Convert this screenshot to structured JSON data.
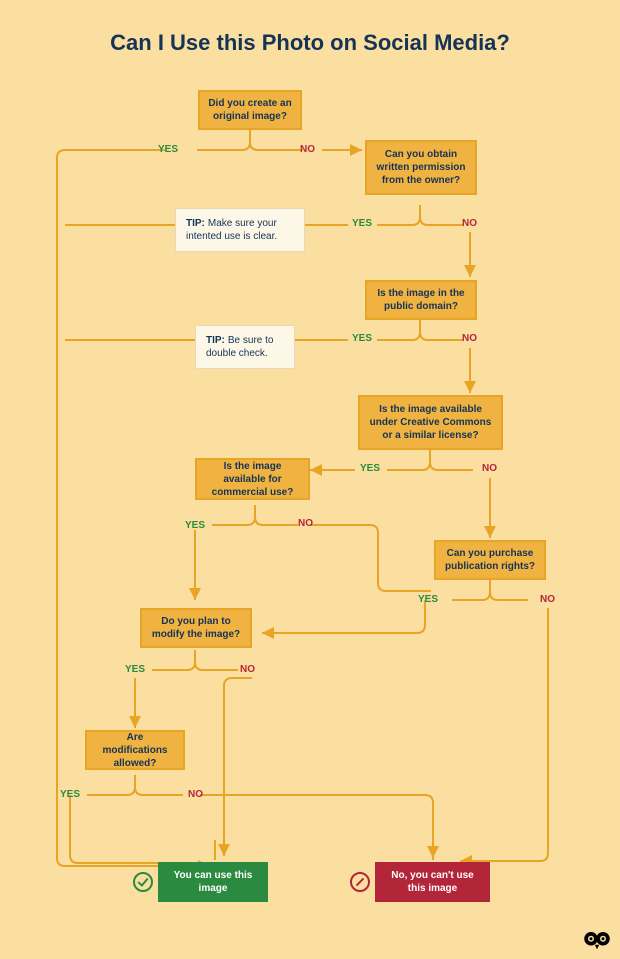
{
  "title": "Can I Use this Photo on Social Media?",
  "labels": {
    "yes": "YES",
    "no": "NO"
  },
  "tips": {
    "t1_prefix": "TIP:",
    "t1_text": "Make sure your intented use is clear.",
    "t2_prefix": "TIP:",
    "t2_text": "Be sure to double check."
  },
  "nodes": {
    "q_create": "Did you create an original image?",
    "q_permission": "Can you obtain written permission from the owner?",
    "q_public": "Is the image in the public domain?",
    "q_cc": "Is the image available under Creative Commons or a similar license?",
    "q_commercial": "Is the image available for commercial use?",
    "q_purchase": "Can you purchase publication rights?",
    "q_modify": "Do you plan to modify the image?",
    "q_modallowed": "Are modifications allowed?"
  },
  "results": {
    "yes": "You can use this image",
    "no": "No, you can't use this image"
  },
  "chart_data": {
    "type": "flowchart",
    "title": "Can I Use this Photo on Social Media?",
    "nodes": [
      {
        "id": "q_create",
        "type": "decision",
        "text": "Did you create an original image?"
      },
      {
        "id": "q_permission",
        "type": "decision",
        "text": "Can you obtain written permission from the owner?"
      },
      {
        "id": "q_public",
        "type": "decision",
        "text": "Is the image in the public domain?"
      },
      {
        "id": "q_cc",
        "type": "decision",
        "text": "Is the image available under Creative Commons or a similar license?"
      },
      {
        "id": "q_commercial",
        "type": "decision",
        "text": "Is the image available for commercial use?"
      },
      {
        "id": "q_purchase",
        "type": "decision",
        "text": "Can you purchase publication rights?"
      },
      {
        "id": "q_modify",
        "type": "decision",
        "text": "Do you plan to modify the image?"
      },
      {
        "id": "q_modallowed",
        "type": "decision",
        "text": "Are modifications allowed?"
      },
      {
        "id": "r_yes",
        "type": "terminal",
        "text": "You can use this image"
      },
      {
        "id": "r_no",
        "type": "terminal",
        "text": "No, you can't use this image"
      }
    ],
    "edges": [
      {
        "from": "q_create",
        "label": "YES",
        "to": "r_yes"
      },
      {
        "from": "q_create",
        "label": "NO",
        "to": "q_permission"
      },
      {
        "from": "q_permission",
        "label": "YES",
        "to": "r_yes",
        "tip": "Make sure your intented use is clear."
      },
      {
        "from": "q_permission",
        "label": "NO",
        "to": "q_public"
      },
      {
        "from": "q_public",
        "label": "YES",
        "to": "r_yes",
        "tip": "Be sure to double check."
      },
      {
        "from": "q_public",
        "label": "NO",
        "to": "q_cc"
      },
      {
        "from": "q_cc",
        "label": "YES",
        "to": "q_commercial"
      },
      {
        "from": "q_cc",
        "label": "NO",
        "to": "q_purchase"
      },
      {
        "from": "q_commercial",
        "label": "YES",
        "to": "q_modify"
      },
      {
        "from": "q_commercial",
        "label": "NO",
        "to": "q_purchase"
      },
      {
        "from": "q_purchase",
        "label": "YES",
        "to": "q_modify"
      },
      {
        "from": "q_purchase",
        "label": "NO",
        "to": "r_no"
      },
      {
        "from": "q_modify",
        "label": "YES",
        "to": "q_modallowed"
      },
      {
        "from": "q_modify",
        "label": "NO",
        "to": "r_yes"
      },
      {
        "from": "q_modallowed",
        "label": "YES",
        "to": "r_yes"
      },
      {
        "from": "q_modallowed",
        "label": "NO",
        "to": "r_no"
      }
    ]
  }
}
